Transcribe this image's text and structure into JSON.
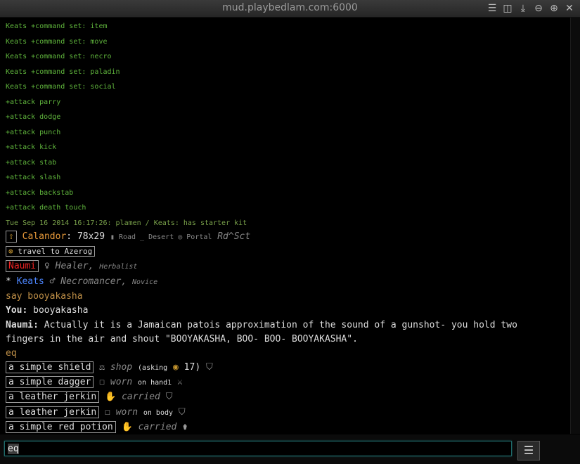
{
  "window": {
    "title": "mud.playbedlam.com:6000"
  },
  "toolbar": {
    "icons": [
      "list-icon",
      "split-icon",
      "download-icon",
      "zoom-out-icon",
      "zoom-in-icon",
      "close-icon"
    ]
  },
  "output": {
    "command_sets": [
      "Keats +command set: item",
      "Keats +command set: move",
      "Keats +command set: necro",
      "Keats +command set: paladin",
      "Keats +command set: social"
    ],
    "attacks": [
      "+attack parry",
      "+attack dodge",
      "+attack punch",
      "+attack kick",
      "+attack stab",
      "+attack slash",
      "+attack backstab",
      "+attack death touch"
    ],
    "timestamp_line": "Tue Sep 16 2014 16:17:26: plamen / Keats: has starter kit",
    "location": {
      "icon_glyph": "⇧",
      "name": "Calandor",
      "sep": ": ",
      "coords": "78x29",
      "terrain": "▮ Road _ Desert ◎ Portal",
      "road_code": "Rd^Sct"
    },
    "travel": {
      "icon_glyph": "⊛",
      "label": "travel to Azerog"
    },
    "npc": {
      "name": "Naumi",
      "gender": "♀",
      "class": "Healer",
      "sub": "Herbalist"
    },
    "player": {
      "marker": "*",
      "name": "Keats",
      "gender": "♂",
      "class": "Necromancer",
      "sub": "Novice"
    },
    "say_cmd": "say booyakasha",
    "you_label": "You:",
    "you_text": "booyakasha",
    "naumi_label": "Naumi:",
    "naumi_line1": "Actually it is a Jamaican patois approximation of the sound of a gunshot- you hold two",
    "naumi_line2": "fingers in the air and shout \"BOOYAKASHA, BOO- BOO- BOOYAKASHA\".",
    "eq_cmd": "eq",
    "equipment": [
      {
        "item": "a simple shield",
        "status_icon": "⚖",
        "status": "shop",
        "extra": "(asking",
        "coin": "◉",
        "price": "17)",
        "slot_icon": "⛉"
      },
      {
        "item": "a simple dagger",
        "status_icon": "☐",
        "status": "worn",
        "loc": "on hand1",
        "slot_icon": "⚔"
      },
      {
        "item": "a leather jerkin",
        "status_icon": "✋",
        "status": "carried",
        "slot_icon": "⛉"
      },
      {
        "item": "a leather jerkin",
        "status_icon": "☐",
        "status": "worn",
        "loc": "on body",
        "slot_icon": "⛉"
      },
      {
        "item": "a simple red potion",
        "status_icon": "✋",
        "status": "carried",
        "slot_icon": "⚱"
      }
    ]
  },
  "input": {
    "value": "eq"
  },
  "menu_button": {
    "glyph": "☰"
  }
}
